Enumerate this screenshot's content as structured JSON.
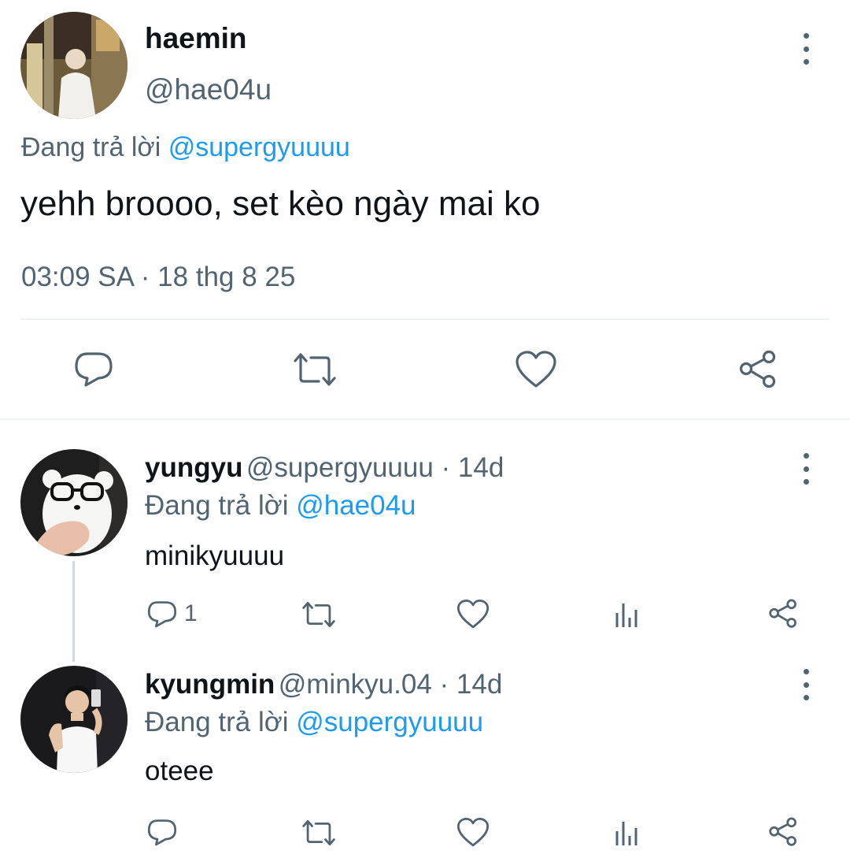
{
  "main_tweet": {
    "display_name": "haemin",
    "handle": "@hae04u",
    "replying_prefix": "Đang trả lời ",
    "replying_mention": "@supergyuuuu",
    "text": "yehh broooo, set kèo ngày mai ko",
    "timestamp": "03:09 SA · 18 thg 8 25",
    "actions": [
      "reply-icon",
      "retweet-icon",
      "like-icon",
      "share-icon"
    ]
  },
  "replies": [
    {
      "display_name": "yungyu",
      "handle": "@supergyuuuu",
      "age": " · 14d",
      "replying_prefix": "Đang trả lời ",
      "replying_mention": "@hae04u",
      "text": "minikyuuuu",
      "reply_count": "1"
    },
    {
      "display_name": "kyungmin",
      "handle": "@minkyu.04",
      "age": " · 14d",
      "replying_prefix": "Đang trả lời ",
      "replying_mention": "@supergyuuuu",
      "text": "oteee",
      "reply_count": ""
    }
  ],
  "colors": {
    "text": "#0f1419",
    "secondary": "#536471",
    "mention": "#1d9bf0",
    "divider": "#eff3f4"
  }
}
